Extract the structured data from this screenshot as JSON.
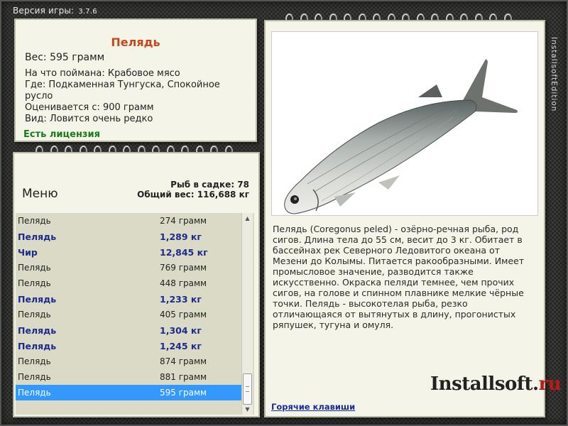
{
  "version": {
    "label": "Версия игры:",
    "number": "3.7.6"
  },
  "info": {
    "title": "Пелядь",
    "weight": "Вес: 595 грамм",
    "lines": [
      "На что поймана: Крабовое мясо",
      "Где: Подкаменная Тунгуска, Спокойное русло",
      "Оценивается с: 900 грамм",
      "Вид: Ловится очень редко"
    ],
    "license": "Есть лицензия"
  },
  "menu": {
    "label": "Меню",
    "stats": {
      "count": "Рыб в садке: 78",
      "total": "Общий вес: 116,688 кг"
    }
  },
  "catch": [
    {
      "name": "Пелядь",
      "weight": "274 грамм",
      "big": false,
      "selected": false
    },
    {
      "name": "Пелядь",
      "weight": "1,289 кг",
      "big": true,
      "selected": false
    },
    {
      "name": "Чир",
      "weight": "12,845 кг",
      "big": true,
      "selected": false
    },
    {
      "name": "Пелядь",
      "weight": "769 грамм",
      "big": false,
      "selected": false
    },
    {
      "name": "Пелядь",
      "weight": "448 грамм",
      "big": false,
      "selected": false
    },
    {
      "name": "Пелядь",
      "weight": "1,233 кг",
      "big": true,
      "selected": false
    },
    {
      "name": "Пелядь",
      "weight": "405 грамм",
      "big": false,
      "selected": false
    },
    {
      "name": "Пелядь",
      "weight": "1,304 кг",
      "big": true,
      "selected": false
    },
    {
      "name": "Пелядь",
      "weight": "1,245 кг",
      "big": true,
      "selected": false
    },
    {
      "name": "Пелядь",
      "weight": "874 грамм",
      "big": false,
      "selected": false
    },
    {
      "name": "Пелядь",
      "weight": "881 грамм",
      "big": false,
      "selected": false
    },
    {
      "name": "Пелядь",
      "weight": "595 грамм",
      "big": false,
      "selected": true
    }
  ],
  "description": "Пелядь (Coregonus peled) - озёрно-речная рыба, род сигов. Длина тела до 55 см, весит до 3 кг. Обитает в бассейнах рек Северного Ледовитого океана от Мезени до Колымы. Питается ракообразными. Имеет промысловое значение, разводится также искусственно. Окраска пеляди темнее, чем прочих сигов, на голове и спинном плавнике мелкие чёрные точки. Пелядь - высокотелая рыба, резко отличающаяся от вытянутых в длину, прогонистых ряпушек, тугуна и омуля.",
  "hotkeys": "Горячие клавиши",
  "watermark": {
    "main": "Installsoft.",
    "tld": "ru"
  },
  "side_text": "InstallsoftEdition",
  "colors": {
    "selected": "#3399ff",
    "big_weight": "#1d2a8e",
    "title": "#c5471b",
    "license": "#1a7a1a"
  }
}
